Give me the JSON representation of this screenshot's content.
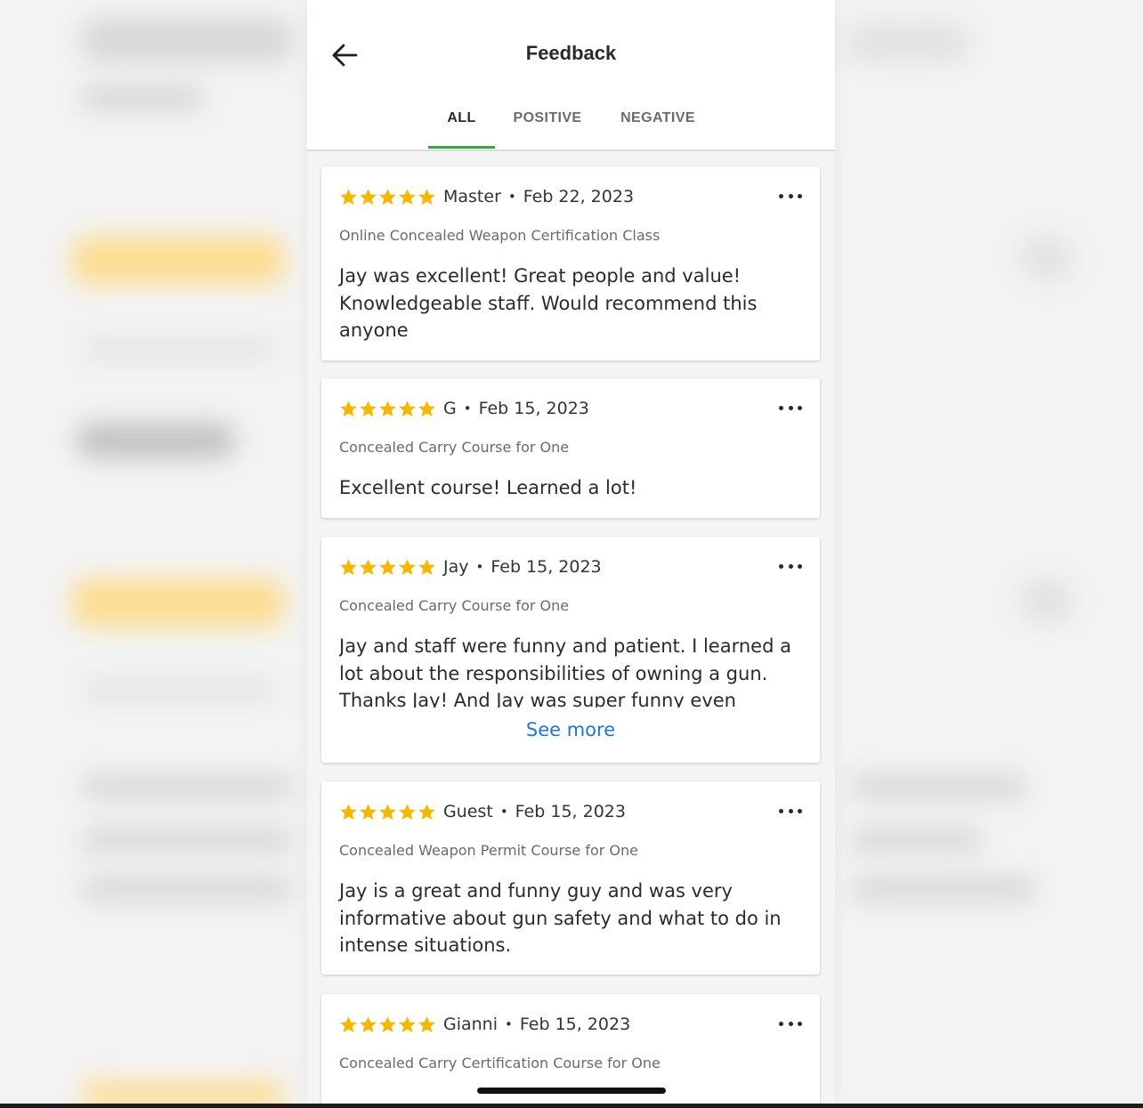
{
  "header": {
    "title": "Feedback",
    "back_icon": "arrow-left-icon"
  },
  "tabs": [
    {
      "label": "ALL",
      "active": true
    },
    {
      "label": "POSITIVE",
      "active": false
    },
    {
      "label": "NEGATIVE",
      "active": false
    }
  ],
  "colors": {
    "accent": "#3aa24a",
    "star": "#f5b800",
    "link": "#1f7ac9"
  },
  "reviews": [
    {
      "rating": 5,
      "reviewer": "Master",
      "separator": "•",
      "date": "Feb 22, 2023",
      "course": "Online Concealed Weapon Certification Class",
      "text": "Jay was excellent! Great people and value! Knowledgeable staff. Would recommend this anyone"
    },
    {
      "rating": 5,
      "reviewer": "G",
      "separator": "•",
      "date": "Feb 15, 2023",
      "course": "Concealed Carry Course for One",
      "text": "Excellent course! Learned a lot!"
    },
    {
      "rating": 5,
      "reviewer": "Jay",
      "separator": "•",
      "date": "Feb 15, 2023",
      "course": "Concealed Carry Course for One",
      "text": "Jay and staff were funny and patient.  I learned a lot about the responsibilities of owning a gun. Thanks Jay! And Jay was super funny even though",
      "see_more": "See more"
    },
    {
      "rating": 5,
      "reviewer": "Guest",
      "separator": "•",
      "date": "Feb 15, 2023",
      "course": "Concealed Weapon Permit Course for One",
      "text": "Jay is a great and funny guy and was very informative about gun safety and what to do in intense situations."
    },
    {
      "rating": 5,
      "reviewer": "Gianni",
      "separator": "•",
      "date": "Feb 15, 2023",
      "course": "Concealed Carry Certification Course for One"
    }
  ],
  "icons": {
    "star": "star-icon",
    "more": "more-horizontal-icon"
  }
}
